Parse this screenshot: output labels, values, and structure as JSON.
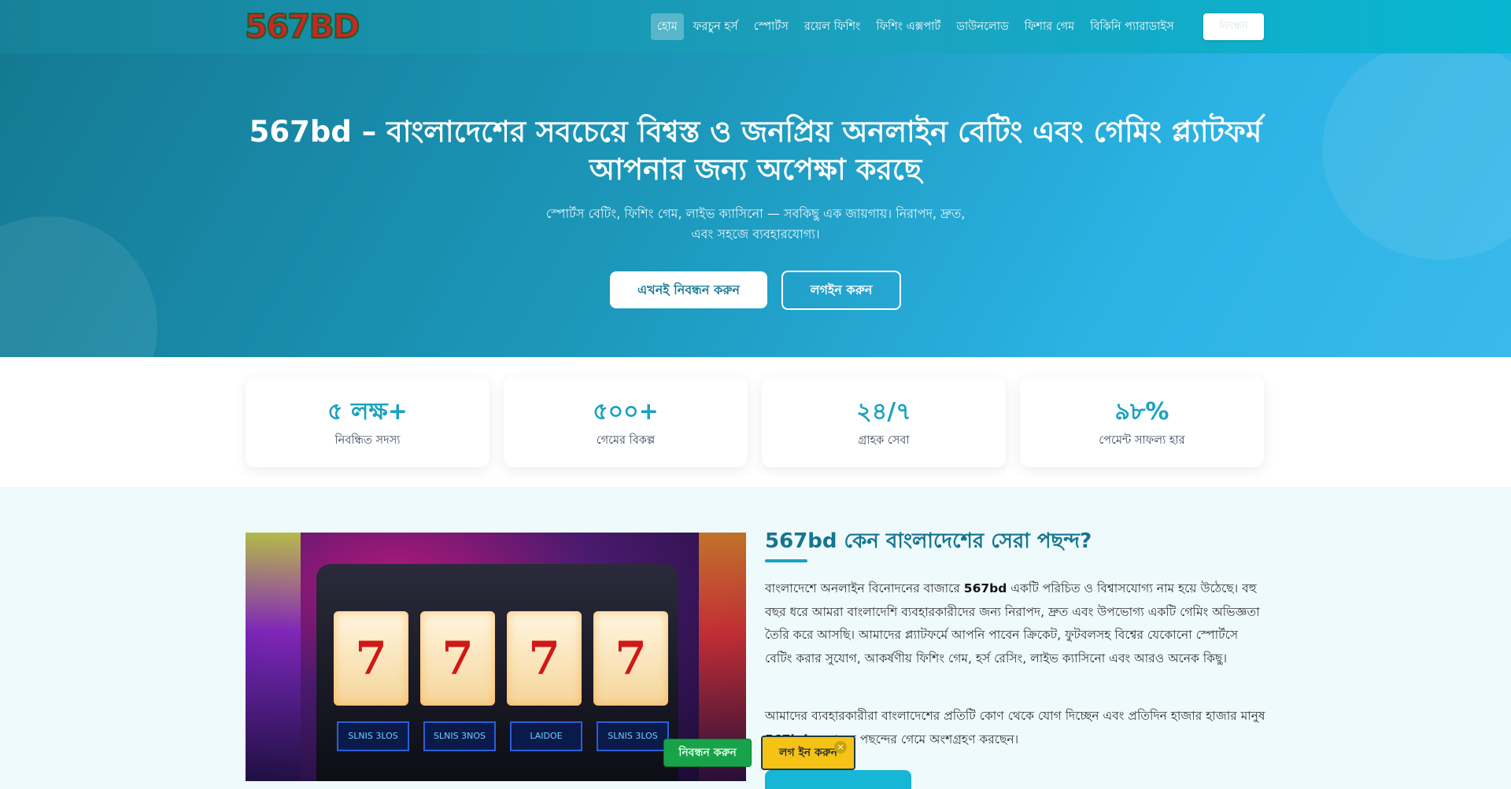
{
  "brand": {
    "logo_text": "567BD"
  },
  "nav": {
    "items": [
      {
        "label": "হোম"
      },
      {
        "label": "ফরচুন হর্স"
      },
      {
        "label": "স্পোর্টস"
      },
      {
        "label": "রয়েল ফিশিং"
      },
      {
        "label": "ফিশিং এক্সপার্ট"
      },
      {
        "label": "ডাউনলোড"
      },
      {
        "label": "ফিশার গেম"
      },
      {
        "label": "বিকিনি প্যারাডাইস"
      }
    ],
    "button_label": "নিবন্ধন"
  },
  "hero": {
    "title_line1": "567bd – বাংলাদেশের সবচেয়ে বিশ্বস্ত ও জনপ্রিয় অনলাইন বেটিং এবং গেমিং প্ল্যাটফর্ম",
    "title_line2": "আপনার জন্য অপেক্ষা করছে",
    "subtitle_line1": "স্পোর্টস বেটিং, ফিশিং গেম, লাইভ ক্যাসিনো — সবকিছু এক জায়গায়। নিরাপদ, দ্রুত,",
    "subtitle_line2": "এবং সহজে ব্যবহারযোগ্য।",
    "primary_button": "এখনই নিবন্ধন করুন",
    "secondary_button": "লগইন করুন"
  },
  "stats": [
    {
      "value": "৫ লক্ষ+",
      "label": "নিবন্ধিত সদস্য"
    },
    {
      "value": "৫০০+",
      "label": "গেমের বিকল্প"
    },
    {
      "value": "২৪/৭",
      "label": "গ্রাহক সেবা"
    },
    {
      "value": "৯৮%",
      "label": "পেমেন্ট সাফল্য হার"
    }
  ],
  "about": {
    "title": "567bd কেন বাংলাদেশের সেরা পছন্দ?",
    "para1_before": "বাংলাদেশে অনলাইন বিনোদনের বাজারে ",
    "para1_bold": "567bd",
    "para1_after": " একটি পরিচিত ও বিশ্বাসযোগ্য নাম হয়ে উঠেছে। বহু বছর ধরে আমরা বাংলাদেশি ব্যবহারকারীদের জন্য নিরাপদ, দ্রুত এবং উপভোগ্য একটি গেমিং অভিজ্ঞতা তৈরি করে আসছি। আমাদের প্ল্যাটফর্মে আপনি পাবেন ক্রিকেট, ফুটবলসহ বিশ্বের যেকোনো স্পোর্টসে বেটিং করার সুযোগ, আকর্ষণীয় ফিশিং গেম, হর্স রেসিং, লাইভ ক্যাসিনো এবং আরও অনেক কিছু।",
    "para2_before": "আমাদের ব্যবহারকারীরা বাংলাদেশের প্রতিটি কোণ থেকে যোগ দিচ্ছেন এবং প্রতিদিন হাজার হাজার মানুষ ",
    "para2_bold": "567bd",
    "para2_after": "-এ তাদের পছন্দের গেমে অংশগ্রহণ করছেন।"
  },
  "slot_image": {
    "reel_symbol": "7",
    "screens": [
      "SLNIS 3LOS",
      "SLNIS 3NOS",
      "LAIDOE",
      "SLNIS 3LOS"
    ]
  },
  "floating": {
    "register_label": "নিবন্ধন করুন",
    "login_label": "লগ ইন করুন",
    "close_symbol": "×"
  }
}
